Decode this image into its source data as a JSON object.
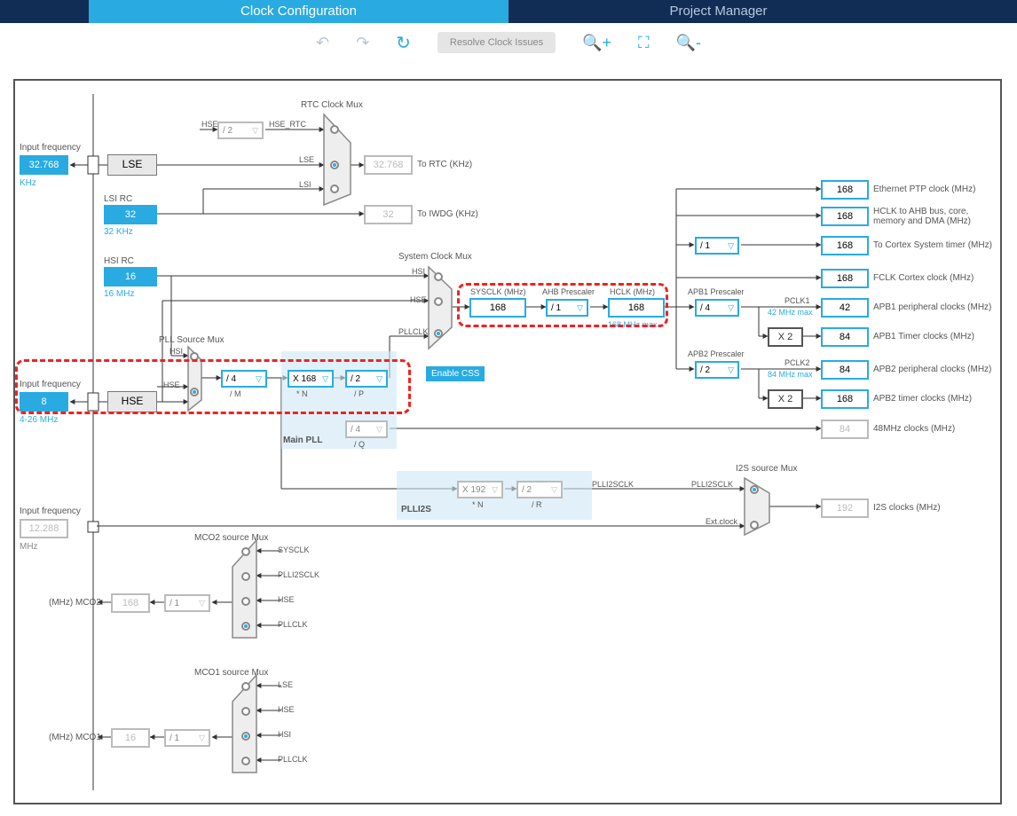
{
  "tabs": {
    "clock": "Clock Configuration",
    "pm": "Project Manager"
  },
  "toolbar": {
    "resolve": "Resolve Clock Issues"
  },
  "inputs": {
    "lse_label": "Input frequency",
    "lse_val": "32.768",
    "lse_unit": "KHz",
    "hse_label": "Input frequency",
    "hse_val": "8",
    "hse_unit": "4-26 MHz",
    "i2s_label": "Input frequency",
    "i2s_val": "12.288",
    "i2s_unit": "MHz"
  },
  "blocks": {
    "lse": "LSE",
    "lsi_rc": "LSI RC",
    "lsi_val": "32",
    "lsi_unit": "32 KHz",
    "hsi_rc": "HSI RC",
    "hsi_val": "16",
    "hsi_unit": "16 MHz",
    "hse": "HSE"
  },
  "rtc": {
    "title": "RTC Clock Mux",
    "hse": "HSE",
    "div2": "/ 2",
    "hse_rtc": "HSE_RTC",
    "lse": "LSE",
    "lsi": "LSI",
    "rtc_out": "32.768",
    "rtc_lbl": "To RTC (KHz)",
    "iwdg_out": "32",
    "iwdg_lbl": "To IWDG (KHz)"
  },
  "pll": {
    "srcmux": "PLL Source Mux",
    "hsi": "HSI",
    "hse": "HSE",
    "m": "/ 4",
    "m_lbl": "/ M",
    "n": "X 168",
    "n_lbl": "* N",
    "p": "/ 2",
    "p_lbl": "/ P",
    "q": "/ 4",
    "q_lbl": "/ Q",
    "main": "Main PLL"
  },
  "sys": {
    "title": "System Clock Mux",
    "hsi": "HSI",
    "hse": "HSE",
    "pllclk": "PLLCLK",
    "sysclk_lbl": "SYSCLK (MHz)",
    "sysclk": "168",
    "ahb_lbl": "AHB Prescaler",
    "ahb": "/ 1",
    "hclk_lbl": "HCLK (MHz)",
    "hclk": "168",
    "hclk_max": "168 MHz max",
    "enable_css": "Enable CSS"
  },
  "outputs": {
    "eth": {
      "v": "168",
      "l": "Ethernet PTP clock (MHz)"
    },
    "hclk_bus": {
      "v": "168",
      "l": "HCLK to AHB bus, core, memory and DMA (MHz)"
    },
    "cortex_div": "/ 1",
    "cortex": {
      "v": "168",
      "l": "To Cortex System timer (MHz)"
    },
    "fclk": {
      "v": "168",
      "l": "FCLK Cortex clock (MHz)"
    },
    "apb1_lbl": "APB1 Prescaler",
    "apb1": "/ 4",
    "pclk1_lbl": "PCLK1",
    "pclk1_max": "42 MHz max",
    "apb1_periph": {
      "v": "42",
      "l": "APB1 peripheral clocks (MHz)"
    },
    "apb1_x2": "X 2",
    "apb1_timer": {
      "v": "84",
      "l": "APB1 Timer clocks (MHz)"
    },
    "apb2_lbl": "APB2 Prescaler",
    "apb2": "/ 2",
    "pclk2_lbl": "PCLK2",
    "pclk2_max": "84 MHz max",
    "apb2_periph": {
      "v": "84",
      "l": "APB2 peripheral clocks (MHz)"
    },
    "apb2_x2": "X 2",
    "apb2_timer": {
      "v": "168",
      "l": "APB2 timer clocks (MHz)"
    },
    "mhz48": {
      "v": "84",
      "l": "48MHz clocks (MHz)"
    }
  },
  "plli2s": {
    "title": "PLLI2S",
    "n": "X 192",
    "n_lbl": "* N",
    "r": "/ 2",
    "r_lbl": "/ R",
    "clk": "PLLI2SCLK",
    "ext": "Ext.clock",
    "mux": "I2S source Mux",
    "out": "192",
    "out_lbl": "I2S clocks (MHz)"
  },
  "mco2": {
    "title": "MCO2 source Mux",
    "sysclk": "SYSCLK",
    "plli2s": "PLLI2SCLK",
    "hse": "HSE",
    "pllclk": "PLLCLK",
    "div": "/ 1",
    "out": "168",
    "lbl": "(MHz) MCO2"
  },
  "mco1": {
    "title": "MCO1 source Mux",
    "lse": "LSE",
    "hse": "HSE",
    "hsi": "HSI",
    "pllclk": "PLLCLK",
    "div": "/ 1",
    "out": "16",
    "lbl": "(MHz) MCO1"
  }
}
